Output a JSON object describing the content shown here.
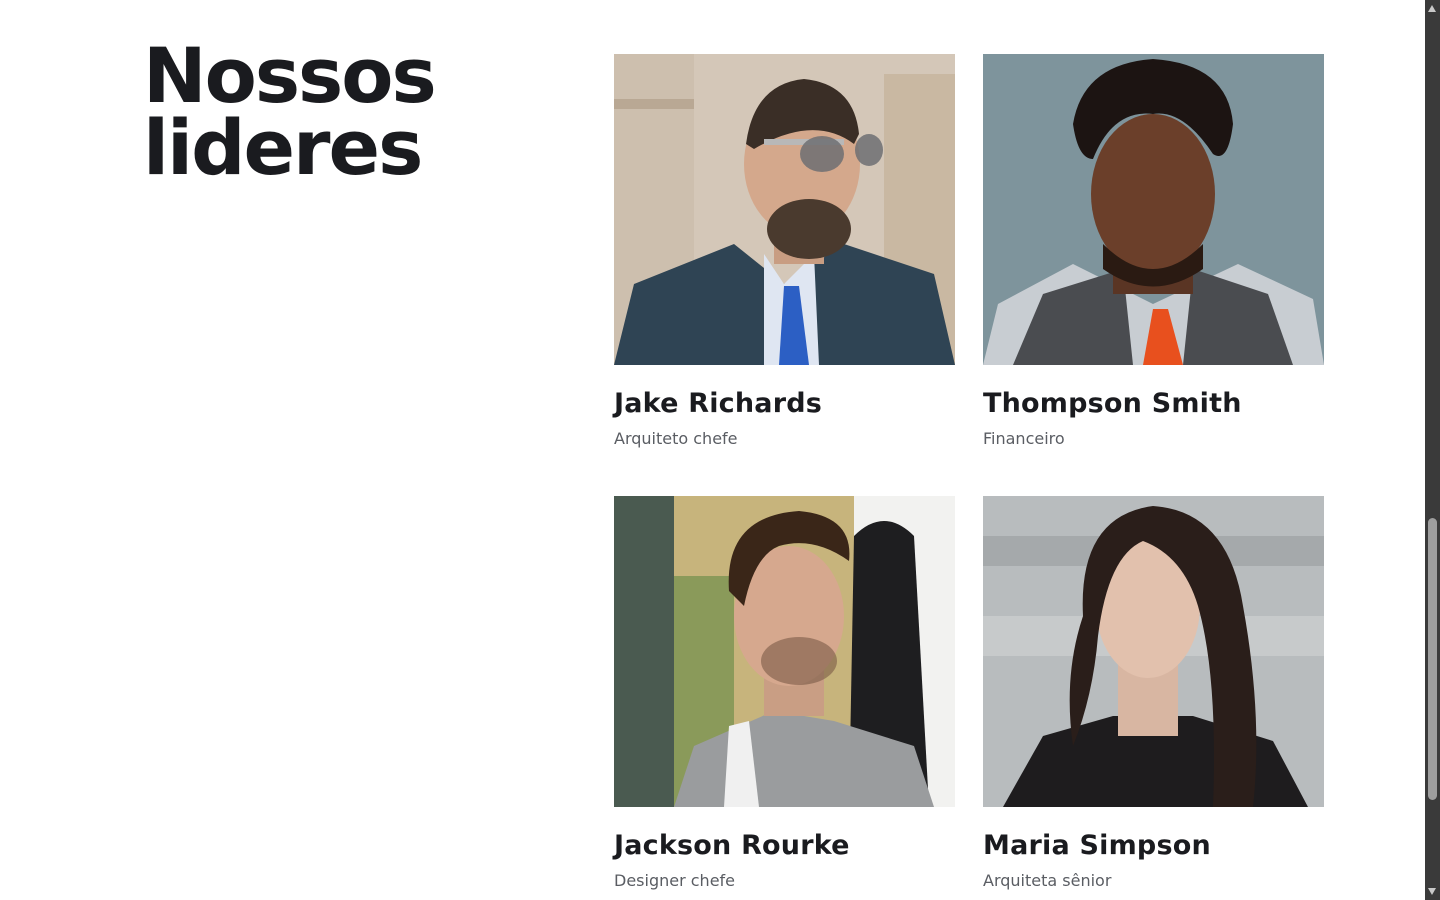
{
  "section": {
    "title": "Nossos lideres"
  },
  "leaders": [
    {
      "name": "Jake Richards",
      "role": "Arquiteto chefe"
    },
    {
      "name": "Thompson Smith",
      "role": "Financeiro"
    },
    {
      "name": "Jackson Rourke",
      "role": "Designer chefe"
    },
    {
      "name": "Maria Simpson",
      "role": "Arquiteta sênior"
    }
  ],
  "icons": {
    "scroll_up": "arrow-up-icon",
    "scroll_down": "arrow-down-icon"
  },
  "colors": {
    "heading": "#1a1b1f",
    "role_text": "#5a5d63",
    "background": "#ffffff",
    "scrollbar_track": "#3a3a3a",
    "scrollbar_thumb": "#9e9e9e"
  }
}
